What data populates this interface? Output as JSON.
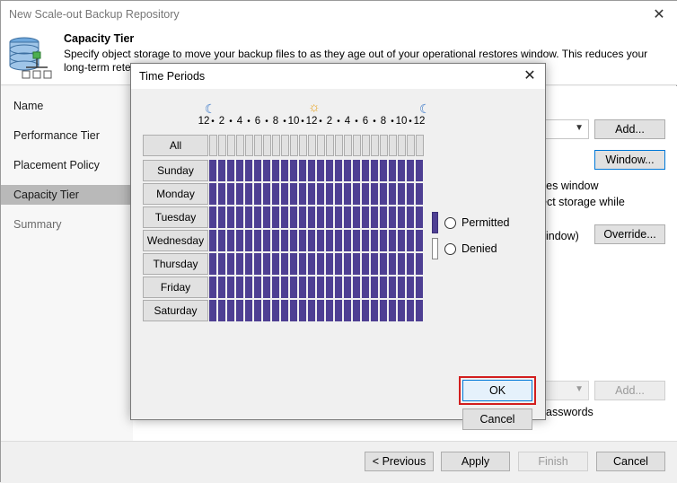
{
  "wizard": {
    "title": "New Scale-out Backup Repository",
    "close_glyph": "✕",
    "header": {
      "title": "Capacity Tier",
      "description": "Specify object storage to move your backup files to as they age out of your operational restores window. This reduces your long-term rete"
    },
    "nav": [
      {
        "label": "Name",
        "state": "normal"
      },
      {
        "label": "Performance Tier",
        "state": "normal"
      },
      {
        "label": "Placement Policy",
        "state": "normal"
      },
      {
        "label": "Capacity Tier",
        "state": "active"
      },
      {
        "label": "Summary",
        "state": "dim"
      }
    ],
    "content": {
      "add_button": "Add...",
      "window_button": "Window...",
      "text_restores_window": "res window",
      "text_object_storage": "ect storage while",
      "text_indow": "indow)",
      "override_button": "Override...",
      "add_button_2": "Add...",
      "text_passwords": "asswords"
    },
    "footer": {
      "previous": "< Previous",
      "apply": "Apply",
      "finish": "Finish",
      "cancel": "Cancel"
    }
  },
  "dialog": {
    "title": "Time Periods",
    "close_glyph": "✕",
    "hour_labels": [
      "12",
      "•",
      "2",
      "•",
      "4",
      "•",
      "6",
      "•",
      "8",
      "•",
      "10",
      "•",
      "12",
      "•",
      "2",
      "•",
      "4",
      "•",
      "6",
      "•",
      "8",
      "•",
      "10",
      "•",
      "12"
    ],
    "all_label": "All",
    "days": [
      "Sunday",
      "Monday",
      "Tuesday",
      "Wednesday",
      "Thursday",
      "Friday",
      "Saturday"
    ],
    "hours_per_day": 24,
    "schedule_state": "all-permitted",
    "colors": {
      "permitted": "#4e3f93",
      "denied": "#ffffff"
    },
    "permitted_label": "Permitted",
    "denied_label": "Denied",
    "ok_label": "OK",
    "cancel_label": "Cancel",
    "icons": {
      "moon": "moon-icon",
      "sun": "sun-icon"
    }
  }
}
